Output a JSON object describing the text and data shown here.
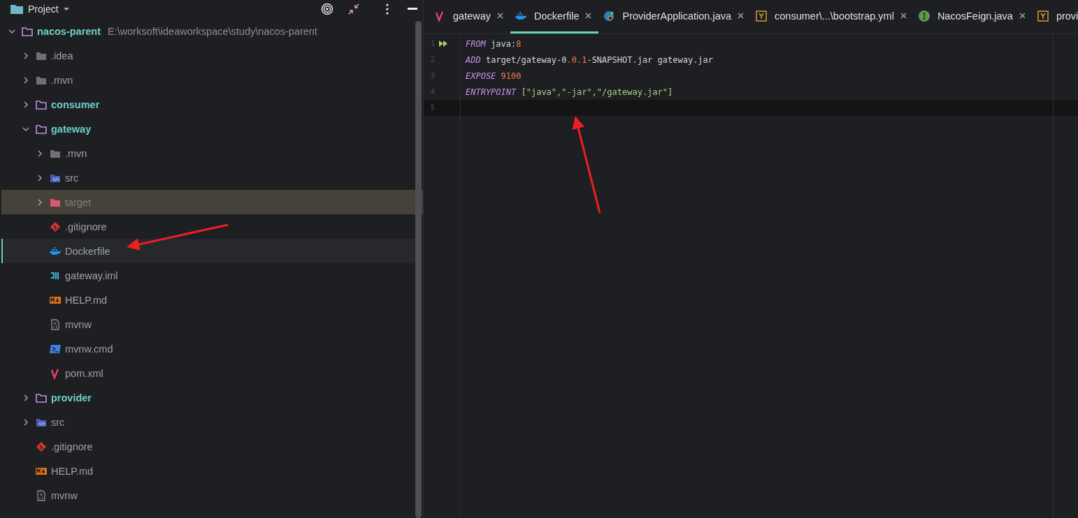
{
  "project_panel": {
    "title": "Project",
    "tree": [
      {
        "label": "nacos-parent",
        "path": "E:\\worksoft\\ideaworkspace\\study\\nacos-parent",
        "kind": "module",
        "expanded": true,
        "selected": false,
        "hovered": false,
        "children": [
          {
            "label": ".idea",
            "kind": "folder",
            "expanded": false,
            "selected": false,
            "hovered": false
          },
          {
            "label": ".mvn",
            "kind": "folder",
            "expanded": false,
            "selected": false,
            "hovered": false
          },
          {
            "label": "consumer",
            "kind": "module",
            "expanded": false,
            "selected": false,
            "hovered": false
          },
          {
            "label": "gateway",
            "kind": "module",
            "expanded": true,
            "selected": false,
            "hovered": false,
            "children": [
              {
                "label": ".mvn",
                "kind": "folder",
                "expanded": false,
                "selected": false,
                "hovered": false
              },
              {
                "label": "src",
                "kind": "source-folder",
                "expanded": false,
                "selected": false,
                "hovered": false
              },
              {
                "label": "target",
                "kind": "excluded-folder",
                "expanded": false,
                "selected": false,
                "hovered": true
              },
              {
                "label": ".gitignore",
                "kind": "git",
                "selected": false,
                "hovered": false
              },
              {
                "label": "Dockerfile",
                "kind": "docker",
                "selected": true,
                "hovered": false
              },
              {
                "label": "gateway.iml",
                "kind": "iml",
                "selected": false,
                "hovered": false
              },
              {
                "label": "HELP.md",
                "kind": "markdown",
                "selected": false,
                "hovered": false
              },
              {
                "label": "mvnw",
                "kind": "script",
                "selected": false,
                "hovered": false
              },
              {
                "label": "mvnw.cmd",
                "kind": "cmd",
                "selected": false,
                "hovered": false
              },
              {
                "label": "pom.xml",
                "kind": "maven",
                "selected": false,
                "hovered": false
              }
            ]
          },
          {
            "label": "provider",
            "kind": "module",
            "expanded": false,
            "selected": false,
            "hovered": false
          },
          {
            "label": "src",
            "kind": "source-folder",
            "expanded": false,
            "selected": false,
            "hovered": false
          },
          {
            "label": ".gitignore",
            "kind": "git",
            "selected": false,
            "hovered": false
          },
          {
            "label": "HELP.md",
            "kind": "markdown",
            "selected": false,
            "hovered": false
          },
          {
            "label": "mvnw",
            "kind": "script",
            "selected": false,
            "hovered": false
          }
        ]
      }
    ]
  },
  "tabs": [
    {
      "label": "gateway",
      "kind": "maven",
      "selected": false,
      "closable": true
    },
    {
      "label": "Dockerfile",
      "kind": "docker",
      "selected": true,
      "closable": true
    },
    {
      "label": "ProviderApplication.java",
      "kind": "spring",
      "selected": false,
      "closable": true
    },
    {
      "label": "consumer\\...\\bootstrap.yml",
      "kind": "yaml",
      "selected": false,
      "closable": true
    },
    {
      "label": "NacosFeign.java",
      "kind": "interface",
      "selected": false,
      "closable": true
    },
    {
      "label": "provi",
      "kind": "yaml",
      "selected": false,
      "closable": false
    }
  ],
  "editor": {
    "lines": [
      {
        "number": "1",
        "run": true,
        "current": false,
        "tokens": [
          {
            "color": "#c792ea",
            "italic": true,
            "text": "FROM"
          },
          {
            "color": "#d6d8dc",
            "italic": false,
            "text": " java:"
          },
          {
            "color": "#f07c52",
            "italic": false,
            "text": "8"
          }
        ]
      },
      {
        "number": "2",
        "run": false,
        "current": false,
        "tokens": [
          {
            "color": "#c792ea",
            "italic": true,
            "text": "ADD"
          },
          {
            "color": "#d6d8dc",
            "italic": false,
            "text": " target/gateway-0"
          },
          {
            "color": "#f07c52",
            "italic": false,
            "text": ".0.1"
          },
          {
            "color": "#d6d8dc",
            "italic": false,
            "text": "-SNAPSHOT.jar gateway.jar"
          }
        ]
      },
      {
        "number": "3",
        "run": false,
        "current": false,
        "tokens": [
          {
            "color": "#c792ea",
            "italic": true,
            "text": "EXPOSE "
          },
          {
            "color": "#f07c52",
            "italic": false,
            "text": "9100"
          }
        ]
      },
      {
        "number": "4",
        "run": false,
        "current": false,
        "tokens": [
          {
            "color": "#c792ea",
            "italic": true,
            "text": "ENTRYPOINT "
          },
          {
            "color": "#a9d37b",
            "italic": false,
            "text": "[\"java\",\"-jar\",\"/gateway.jar\"]"
          }
        ]
      },
      {
        "number": "5",
        "run": false,
        "current": true
      }
    ]
  }
}
